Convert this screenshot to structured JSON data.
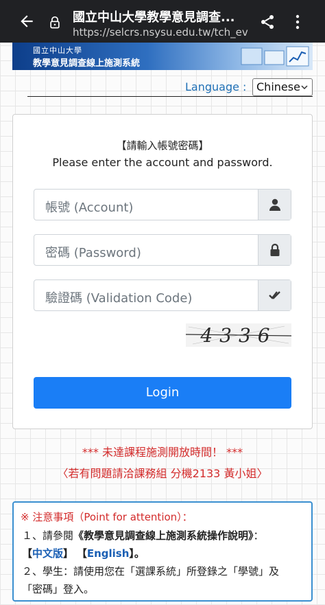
{
  "browser": {
    "title": "國立中山大學教學意見調查...",
    "url": "https://selcrs.nsysu.edu.tw/tch_eva",
    "icons": [
      "back-arrow-icon",
      "lock-icon",
      "share-icon",
      "more-vert-icon"
    ]
  },
  "banner": {
    "line1": "國立中山大學",
    "line2": "教學意見調查線上施測系統"
  },
  "language": {
    "label": "Language :",
    "selected": "Chinese"
  },
  "login_card": {
    "heading_zh": "【請輸入帳號密碼】",
    "heading_en": "Please enter the account and password.",
    "account_placeholder": "帳號 (Account)",
    "password_placeholder": "密碼 (Password)",
    "captcha_placeholder": "驗證碼 (Validation Code)",
    "captcha_text": "4336",
    "login_label": "Login",
    "colors": {
      "button": "#1a7ef6",
      "addon": "#e9ecef"
    }
  },
  "notice": {
    "line1": "*** 未達課程施測開放時間！ ***",
    "line2": "〈若有問題請洽課務組 分機2133 黃小姐〉",
    "color": "#d32b2b"
  },
  "attention": {
    "title": "※ 注意事項（Point for attention）：",
    "item1_prefix": "１、請參閱",
    "item1_doc": "《教學意見調查線上施測系統操作說明》",
    "item1_suffix": "：",
    "link_zh": "中文版",
    "link_en": "English",
    "item2_line1": "２、學生：請使用您在「選課系統」所登錄之「學號」及",
    "item2_line2": "「密碼」登入。"
  }
}
